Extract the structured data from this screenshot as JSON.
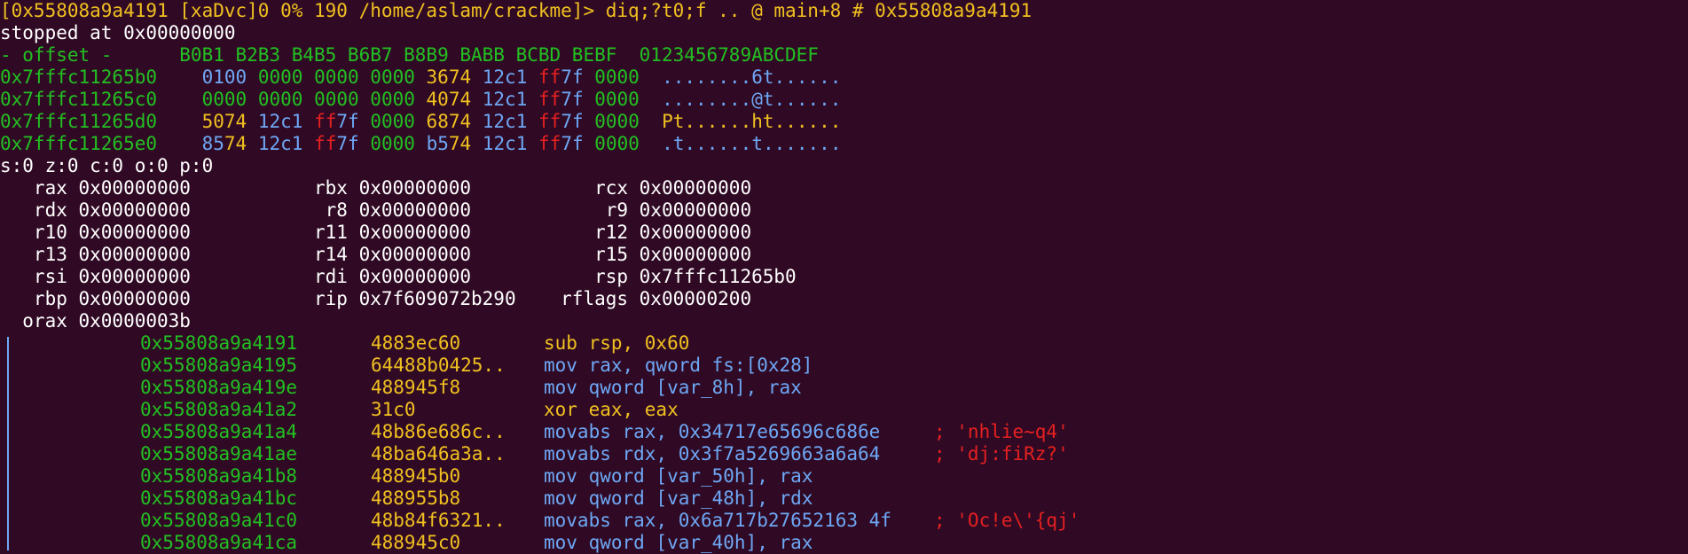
{
  "prompt": {
    "text": "[0x55808a9a4191 [xaDvc]0 0% 190 /home/aslam/crackme]> diq;?t0;f .. @ main+8 # 0x55808a9a4191"
  },
  "status": {
    "text": "stopped at 0x00000000"
  },
  "hexdump": {
    "header": "- offset -      B0B1 B2B3 B4B5 B6B7 B8B9 BABB BCBD BEBF  0123456789ABCDEF",
    "rows": [
      {
        "offset": "0x7fffc11265b0",
        "w": [
          "0100",
          "0000",
          "0000",
          "0000",
          "3674",
          "12c1",
          "ff7f",
          "0000"
        ],
        "ascii": "........6t......"
      },
      {
        "offset": "0x7fffc11265c0",
        "w": [
          "0000",
          "0000",
          "0000",
          "0000",
          "4074",
          "12c1",
          "ff7f",
          "0000"
        ],
        "ascii": "........@t......"
      },
      {
        "offset": "0x7fffc11265d0",
        "w": [
          "5074",
          "12c1",
          "ff7f",
          "0000",
          "6874",
          "12c1",
          "ff7f",
          "0000"
        ],
        "ascii": "Pt......ht......"
      },
      {
        "offset": "0x7fffc11265e0",
        "w": [
          "8574",
          "12c1",
          "ff7f",
          "0000",
          "b574",
          "12c1",
          "ff7f",
          "0000"
        ],
        "ascii": ".t......t......."
      }
    ]
  },
  "flags": {
    "text": "s:0 z:0 c:0 o:0 p:0"
  },
  "registers": {
    "rows": [
      [
        "   rax 0x00000000           rbx 0x00000000           rcx 0x00000000"
      ],
      [
        "   rdx 0x00000000            r8 0x00000000            r9 0x00000000"
      ],
      [
        "   r10 0x00000000           r11 0x00000000           r12 0x00000000"
      ],
      [
        "   r13 0x00000000           r14 0x00000000           r15 0x00000000"
      ],
      [
        "   rsi 0x00000000           rdi 0x00000000           rsp 0x7fffc11265b0"
      ],
      [
        "   rbp 0x00000000           rip 0x7f609072b290    rflags 0x00000200"
      ],
      [
        "  orax 0x0000003b"
      ]
    ]
  },
  "disasm": [
    {
      "addr": "0x55808a9a4191",
      "bytes": "4883ec60",
      "op": "sub rsp, 0x60",
      "comment": ""
    },
    {
      "addr": "0x55808a9a4195",
      "bytes": "64488b0425..",
      "op": "mov rax, qword fs:[0x28]",
      "comment": ""
    },
    {
      "addr": "0x55808a9a419e",
      "bytes": "488945f8",
      "op": "mov qword [var_8h], rax",
      "comment": ""
    },
    {
      "addr": "0x55808a9a41a2",
      "bytes": "31c0",
      "op": "xor eax, eax",
      "comment": ""
    },
    {
      "addr": "0x55808a9a41a4",
      "bytes": "48b86e686c..",
      "op": "movabs rax, 0x34717e65696c686e",
      "comment": "; 'nhlie~q4'"
    },
    {
      "addr": "0x55808a9a41ae",
      "bytes": "48ba646a3a..",
      "op": "movabs rdx, 0x3f7a5269663a6a64",
      "comment": "; 'dj:fiRz?'"
    },
    {
      "addr": "0x55808a9a41b8",
      "bytes": "488945b0",
      "op": "mov qword [var_50h], rax",
      "comment": ""
    },
    {
      "addr": "0x55808a9a41bc",
      "bytes": "488955b8",
      "op": "mov qword [var_48h], rdx",
      "comment": ""
    },
    {
      "addr": "0x55808a9a41c0",
      "bytes": "48b84f6321..",
      "op": "movabs rax, 0x6a717b27652163 4f",
      "comment": "; 'Oc!e\\'{qj'"
    },
    {
      "addr": "0x55808a9a41ca",
      "bytes": "488945c0",
      "op": "mov qword [var_40h], rax",
      "comment": ""
    }
  ],
  "colors": {
    "background": "#300a24",
    "prompt": "#f0c020",
    "offset": "#22c022",
    "blue": "#6ea7f5",
    "red": "#e52020"
  }
}
